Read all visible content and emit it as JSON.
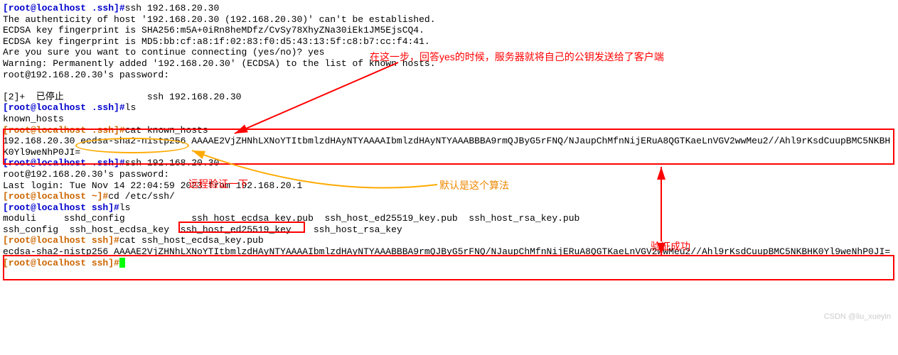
{
  "term": {
    "prompt1": "[root@localhost .ssh]#",
    "prompt_home": "[root@localhost ~]#",
    "prompt_ssh": "[root@localhost ssh]#",
    "cmd_ssh": "ssh 192.168.20.30",
    "auth_line": "The authenticity of host '192.168.20.30 (192.168.20.30)' can't be established.",
    "fp_sha": "ECDSA key fingerprint is SHA256:m5A+0iRn8heMDfz/CvSy78XhyZNa30iEk1JM5EjsCQ4.",
    "fp_md5": "ECDSA key fingerprint is MD5:bb:cf:a8:1f:02:83:f0:d5:43:13:5f:c8:b7:cc:f4:41.",
    "confirm": "Are you sure you want to continue connecting (yes/no)? yes",
    "warning": "Warning: Permanently added '192.168.20.30' (ECDSA) to the list of known hosts.",
    "pw_prompt": "root@192.168.20.30's password:",
    "stopped": "[2]+  已停止               ssh 192.168.20.30",
    "cmd_ls": "ls",
    "known_hosts": "known_hosts",
    "cmd_cat_known": "cat known_hosts",
    "kh_ip": "192.168.20.30 ",
    "kh_algo": "ecdsa-sha2-nistp256",
    "kh_key": " AAAAE2VjZHNhLXNoYTItbmlzdHAyNTYAAAAIbmlzdHAyNTYAAABBBA9rmQJByG5rFNQ/NJaupChMfnNijERuA8QGTKaeLnVGV2wwMeu2//Ahl9rKsdCuupBMC5NKBHK0Yl9weNhP0JI=",
    "cmd_ssh2": "ssh 192.168.20.30",
    "pw2": "root@192.168.20.30's password:",
    "last_login": "Last login: Tue Nov 14 22:04:59 2023 from 192.168.20.1",
    "cmd_cd": "cd /etc/ssh/",
    "cmd_ls2": "ls",
    "ls_row1": "moduli     sshd_config            ssh_host_ecdsa_key.pub  ssh_host_ed25519_key.pub  ssh_host_rsa_key.pub",
    "ls_row2": "ssh_config  ssh_host_ecdsa_key  ssh_host_ed25519_key    ssh_host_rsa_key",
    "cmd_cat_pub": "cat ssh_host_ecdsa_key.pub",
    "pub_content": "ecdsa-sha2-nistp256 AAAAE2VjZHNhLXNoYTItbmlzdHAyNTYAAAAIbmlzdHAyNTYAAABBBA9rmQJByG5rFNQ/NJaupChMfnNijERuA8QGTKaeLnVGV2wwMeu2//Ahl9rKsdCuupBMC5NKBHK0Yl9weNhP0JI="
  },
  "annotations": {
    "red1": "在这一步，回答yes的时候，服务器就将自己的公钥发送给了客户端",
    "red2": "远程验证一下",
    "orange1": "默认是这个算法",
    "red3": "验证成功"
  },
  "watermark": "CSDN @liu_xueyin"
}
